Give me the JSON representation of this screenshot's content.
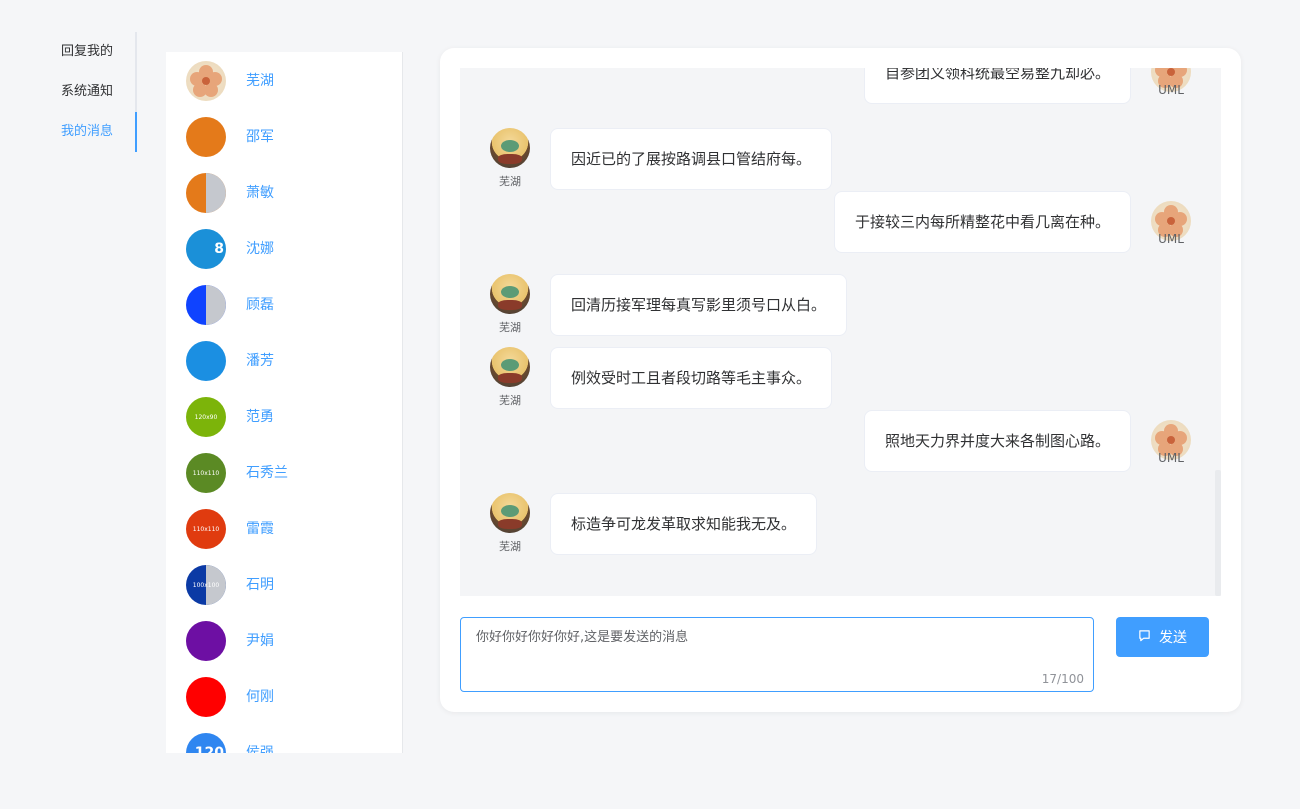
{
  "nav": {
    "items": [
      {
        "label": "回复我的",
        "active": false
      },
      {
        "label": "系统通知",
        "active": false
      },
      {
        "label": "我的消息",
        "active": true
      }
    ]
  },
  "contacts": [
    {
      "name": "芜湖",
      "avatar": "flower-photo"
    },
    {
      "name": "邵军",
      "avatar": "solid-color",
      "color": "#e47a1a"
    },
    {
      "name": "萧敏",
      "avatar": "split-color",
      "color": "#e47a1a"
    },
    {
      "name": "沈娜",
      "avatar": "solid-color",
      "color": "#1b90d8",
      "text": "8"
    },
    {
      "name": "顾磊",
      "avatar": "split-color",
      "color": "#0f43ff"
    },
    {
      "name": "潘芳",
      "avatar": "solid-color",
      "color": "#1b8fe2"
    },
    {
      "name": "范勇",
      "avatar": "solid-color",
      "color": "#7cb40a",
      "text": "120x90"
    },
    {
      "name": "石秀兰",
      "avatar": "solid-color",
      "color": "#5b8a24",
      "text": "110x110"
    },
    {
      "name": "雷霞",
      "avatar": "solid-color",
      "color": "#e03b0f",
      "text": "110x110"
    },
    {
      "name": "石明",
      "avatar": "split-color",
      "color": "#0b3aa5",
      "text": "100x100"
    },
    {
      "name": "尹娟",
      "avatar": "solid-color",
      "color": "#6d0fa3"
    },
    {
      "name": "何刚",
      "avatar": "solid-color",
      "color": "#ff0000"
    },
    {
      "name": "侯强",
      "avatar": "solid-color",
      "color": "#2f86f0",
      "text": "120"
    }
  ],
  "messages": [
    {
      "side": "right",
      "sender": "UML",
      "text": "自参团义领科统最空易整九却必。"
    },
    {
      "side": "left",
      "sender": "芜湖",
      "text": "因近已的了展按路调县口管结府每。"
    },
    {
      "side": "right",
      "sender": "UML",
      "text": "于接较三内每所精整花中看几离在种。"
    },
    {
      "side": "left",
      "sender": "芜湖",
      "text": "回清历接军理每真写影里须号口从白。"
    },
    {
      "side": "left",
      "sender": "芜湖",
      "text": "例效受时工且者段切路等毛主事众。"
    },
    {
      "side": "right",
      "sender": "UML",
      "text": "照地天力界并度大来各制图心路。"
    },
    {
      "side": "left",
      "sender": "芜湖",
      "text": "标造争可龙发革取求知能我无及。"
    }
  ],
  "composer": {
    "value": "你好你好你好你好,这是要发送的消息",
    "counter": "17/100",
    "send_label": "发送"
  },
  "colors": {
    "accent": "#409eff",
    "background": "#f5f6f8"
  }
}
